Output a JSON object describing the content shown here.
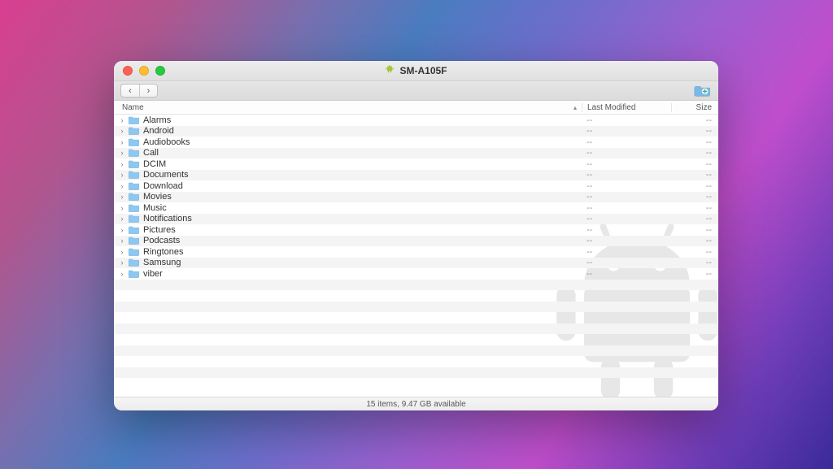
{
  "window": {
    "title": "SM-A105F",
    "app_icon": "android-icon"
  },
  "columns": {
    "name": "Name",
    "modified": "Last Modified",
    "size": "Size",
    "sort_indicator": "▴"
  },
  "items": [
    {
      "name": "Alarms",
      "modified": "--",
      "size": "--"
    },
    {
      "name": "Android",
      "modified": "--",
      "size": "--"
    },
    {
      "name": "Audiobooks",
      "modified": "--",
      "size": "--"
    },
    {
      "name": "Call",
      "modified": "--",
      "size": "--"
    },
    {
      "name": "DCIM",
      "modified": "--",
      "size": "--"
    },
    {
      "name": "Documents",
      "modified": "--",
      "size": "--"
    },
    {
      "name": "Download",
      "modified": "--",
      "size": "--"
    },
    {
      "name": "Movies",
      "modified": "--",
      "size": "--"
    },
    {
      "name": "Music",
      "modified": "--",
      "size": "--"
    },
    {
      "name": "Notifications",
      "modified": "--",
      "size": "--"
    },
    {
      "name": "Pictures",
      "modified": "--",
      "size": "--"
    },
    {
      "name": "Podcasts",
      "modified": "--",
      "size": "--"
    },
    {
      "name": "Ringtones",
      "modified": "--",
      "size": "--"
    },
    {
      "name": "Samsung",
      "modified": "--",
      "size": "--"
    },
    {
      "name": "viber",
      "modified": "--",
      "size": "--"
    }
  ],
  "status": "15 items, 9.47 GB available",
  "glyphs": {
    "disclosure": "›",
    "back": "‹",
    "forward": "›"
  }
}
